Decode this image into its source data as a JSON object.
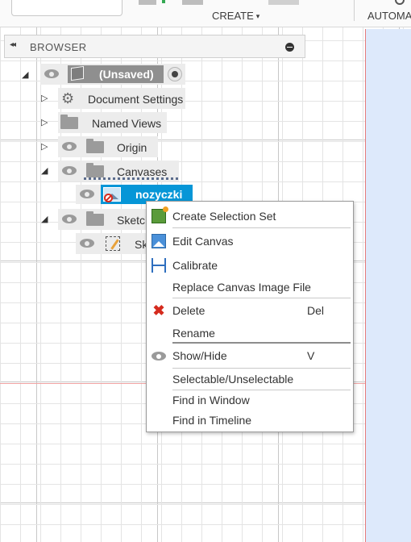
{
  "toolbar": {
    "create_label": "CREATE",
    "create_caret": "▾",
    "automate_label": "AUTOMA"
  },
  "browser": {
    "collapse_glyph": "◂◂",
    "title": "BROWSER",
    "root": {
      "label": "(Unsaved)",
      "expander": "◢"
    },
    "items": [
      {
        "label": "Document Settings",
        "expander": "▷",
        "icon": "gear-icon"
      },
      {
        "label": "Named Views",
        "expander": "▷",
        "icon": "folder-icon"
      },
      {
        "label": "Origin",
        "expander": "▷",
        "icon": "folder-icon"
      },
      {
        "label": "Canvases",
        "expander": "◢",
        "icon": "folder-icon"
      },
      {
        "label": "nozyczki",
        "icon": "canvas-icon",
        "selected": true
      },
      {
        "label": "Sketch",
        "expander": "◢",
        "icon": "folder-icon"
      },
      {
        "label": "Sk",
        "icon": "sketch-icon"
      }
    ]
  },
  "context_menu": {
    "items": [
      {
        "label": "Create Selection Set",
        "icon": "selection-set-icon"
      },
      {
        "label": "Edit Canvas",
        "icon": "edit-canvas-icon"
      },
      {
        "label": "Calibrate",
        "icon": "calibrate-icon"
      },
      {
        "label": "Replace Canvas Image File"
      },
      {
        "label": "Delete",
        "shortcut": "Del",
        "icon": "delete-icon",
        "icon_glyph": "✖"
      },
      {
        "label": "Rename"
      },
      {
        "label": "Show/Hide",
        "shortcut": "V",
        "icon": "eye-icon"
      },
      {
        "label": "Selectable/Unselectable"
      },
      {
        "label": "Find in Window"
      },
      {
        "label": "Find in Timeline"
      }
    ]
  },
  "colors": {
    "selection_blue": "#0696d7",
    "canvas_right_pane": "#dde9fb",
    "axis_red": "#e57b7b",
    "delete_red": "#d52b1e"
  }
}
